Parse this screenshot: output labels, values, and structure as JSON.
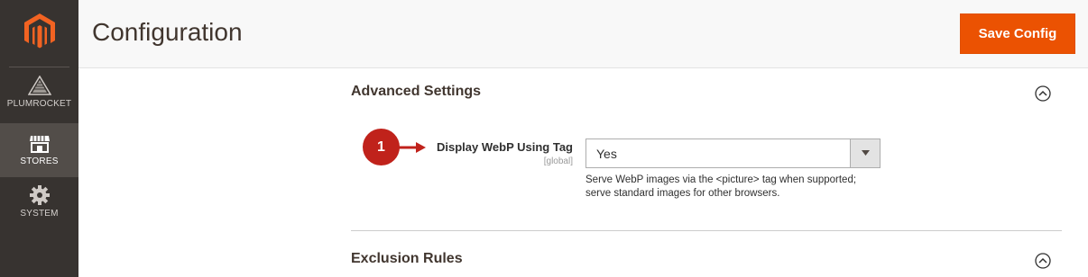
{
  "header": {
    "title": "Configuration",
    "save_label": "Save Config"
  },
  "sidebar": {
    "items": [
      {
        "label": "PLUMROCKET",
        "icon": "plumrocket-icon"
      },
      {
        "label": "STORES",
        "icon": "store-icon",
        "active": true
      },
      {
        "label": "SYSTEM",
        "icon": "gear-icon"
      }
    ]
  },
  "sections": [
    {
      "title": "Advanced Settings",
      "expanded": true
    },
    {
      "title": "Exclusion Rules",
      "expanded": true
    }
  ],
  "field": {
    "label": "Display WebP Using Tag",
    "scope": "[global]",
    "value": "Yes",
    "note_line1": "Serve WebP images via the <picture> tag when supported;",
    "note_line2": "serve standard images for other browsers."
  },
  "annotation": {
    "number": "1"
  },
  "colors": {
    "accent": "#eb5202",
    "sidebar": "#373330",
    "badge": "#c0221b"
  }
}
